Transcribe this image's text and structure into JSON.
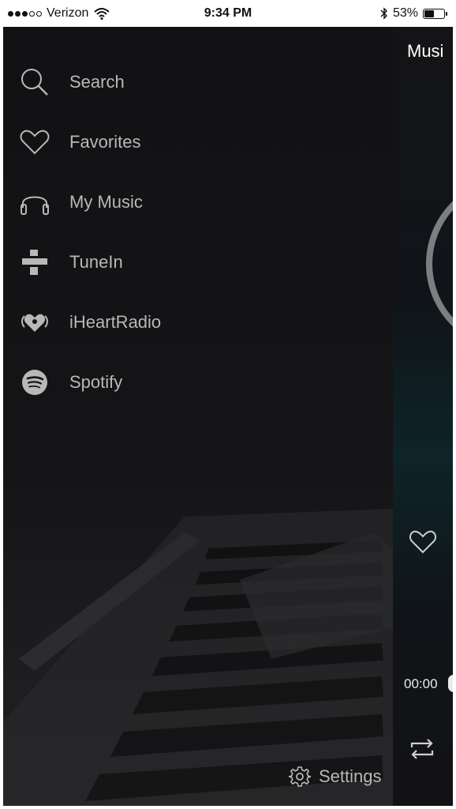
{
  "status_bar": {
    "carrier": "Verizon",
    "time": "9:34 PM",
    "battery": "53%",
    "battery_level": 0.53,
    "signal_bars": 3,
    "signal_total": 5
  },
  "menu": {
    "items": [
      {
        "label": "Search",
        "icon": "search-icon"
      },
      {
        "label": "Favorites",
        "icon": "heart-icon"
      },
      {
        "label": "My Music",
        "icon": "headphones-icon"
      },
      {
        "label": "TuneIn",
        "icon": "tunein-icon"
      },
      {
        "label": "iHeartRadio",
        "icon": "iheartradio-icon"
      },
      {
        "label": "Spotify",
        "icon": "spotify-icon"
      }
    ],
    "settings_label": "Settings"
  },
  "player": {
    "title": "Musi",
    "elapsed": "00:00"
  },
  "colors": {
    "background": "#0f1012",
    "menu_text": "#b8b8b8",
    "accent_teal": "#0e2428"
  }
}
